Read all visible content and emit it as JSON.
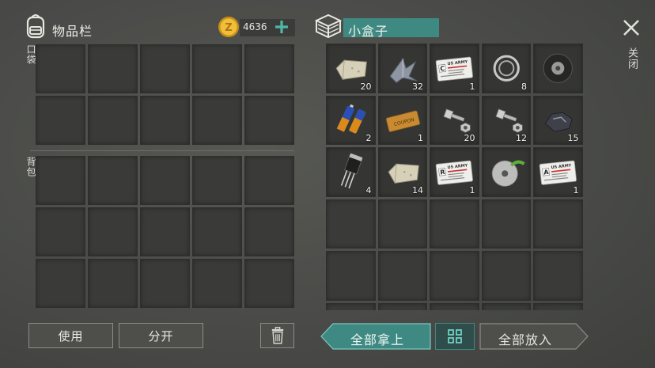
{
  "inventory": {
    "title": "物品栏",
    "coins": "4636",
    "pocket_label": "口袋",
    "backpack_label": "背包",
    "use_button": "使用",
    "split_button": "分开"
  },
  "container": {
    "title": "小盒子",
    "close_label": "关闭",
    "take_all_button": "全部拿上",
    "put_all_button": "全部放入",
    "items": [
      {
        "name": "stone-brick",
        "count": "20"
      },
      {
        "name": "metal-scrap",
        "count": "32"
      },
      {
        "name": "access-card-c",
        "count": "1",
        "card_text": "US ARMY",
        "letter": "C"
      },
      {
        "name": "ball-bearing",
        "count": "8"
      },
      {
        "name": "tire",
        "count": ""
      },
      {
        "name": "batteries",
        "count": "2"
      },
      {
        "name": "coupon-ticket",
        "count": "1",
        "ticket_text": "COUPON"
      },
      {
        "name": "bolt-and-nut",
        "count": "20"
      },
      {
        "name": "bolt-and-nut",
        "count": "12"
      },
      {
        "name": "ore-chunk",
        "count": "15"
      },
      {
        "name": "transistor",
        "count": "4"
      },
      {
        "name": "stone-brick",
        "count": "14"
      },
      {
        "name": "access-card-r",
        "count": "1",
        "card_text": "US ARMY",
        "letter": "R"
      },
      {
        "name": "saw-blade",
        "count": ""
      },
      {
        "name": "access-card-a",
        "count": "1",
        "card_text": "US ARMY",
        "letter": "A"
      }
    ]
  },
  "colors": {
    "accent_teal": "#3e8a83",
    "coin_gold": "#e0a92a",
    "plus_teal": "#4fb7a5"
  }
}
